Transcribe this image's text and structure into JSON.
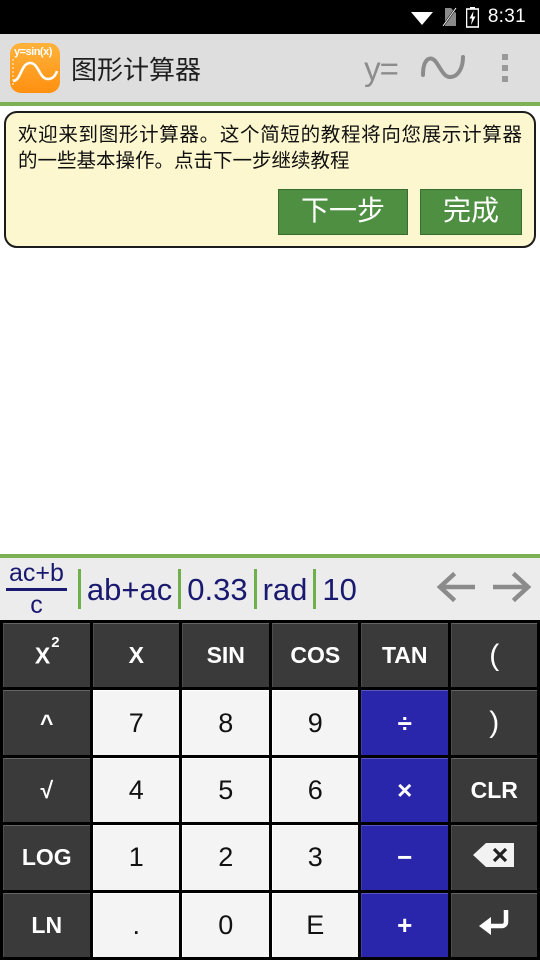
{
  "statusbar": {
    "time": "8:31",
    "icons": [
      "wifi-icon",
      "no-sim-icon",
      "battery-charging-icon"
    ]
  },
  "toolbar": {
    "app_icon_label": "y=sin(x)",
    "title": "图形计算器",
    "actions": [
      {
        "name": "y-equals-button",
        "label": "y="
      },
      {
        "name": "graph-curve-button",
        "label": ""
      },
      {
        "name": "overflow-menu-button",
        "label": ""
      }
    ]
  },
  "tutorial": {
    "text": "欢迎来到图形计算器。这个简短的教程将向您展示计算器的一些基本操作。点击下一步继续教程",
    "next_label": "下一步",
    "done_label": "完成"
  },
  "status_strip": {
    "fraction": {
      "numerator": "ac+b",
      "denominator": "c"
    },
    "expression": "ab+ac",
    "value": "0.33",
    "angle_mode": "rad",
    "base": "10",
    "prev_label": "←",
    "next_label": "→"
  },
  "keypad": {
    "rows": [
      [
        {
          "name": "key-x-squared",
          "label": "X",
          "sup": "2",
          "style": "fn"
        },
        {
          "name": "key-x",
          "label": "X",
          "style": "fn"
        },
        {
          "name": "key-sin",
          "label": "SIN",
          "style": "fn"
        },
        {
          "name": "key-cos",
          "label": "COS",
          "style": "fn"
        },
        {
          "name": "key-tan",
          "label": "TAN",
          "style": "fn"
        },
        {
          "name": "key-open-paren",
          "label": "(",
          "style": "fn-paren"
        }
      ],
      [
        {
          "name": "key-power",
          "label": "^",
          "style": "fn"
        },
        {
          "name": "key-7",
          "label": "7",
          "style": "num"
        },
        {
          "name": "key-8",
          "label": "8",
          "style": "num"
        },
        {
          "name": "key-9",
          "label": "9",
          "style": "num"
        },
        {
          "name": "key-divide",
          "label": "÷",
          "style": "op"
        },
        {
          "name": "key-close-paren",
          "label": ")",
          "style": "fn-paren"
        }
      ],
      [
        {
          "name": "key-sqrt",
          "label": "√",
          "style": "fn"
        },
        {
          "name": "key-4",
          "label": "4",
          "style": "num"
        },
        {
          "name": "key-5",
          "label": "5",
          "style": "num"
        },
        {
          "name": "key-6",
          "label": "6",
          "style": "num"
        },
        {
          "name": "key-multiply",
          "label": "×",
          "style": "op"
        },
        {
          "name": "key-clear",
          "label": "CLR",
          "style": "fn"
        }
      ],
      [
        {
          "name": "key-log",
          "label": "LOG",
          "style": "fn"
        },
        {
          "name": "key-1",
          "label": "1",
          "style": "num"
        },
        {
          "name": "key-2",
          "label": "2",
          "style": "num"
        },
        {
          "name": "key-3",
          "label": "3",
          "style": "num"
        },
        {
          "name": "key-minus",
          "label": "−",
          "style": "op"
        },
        {
          "name": "key-backspace",
          "label": "",
          "style": "fn-backspace"
        }
      ],
      [
        {
          "name": "key-ln",
          "label": "LN",
          "style": "fn"
        },
        {
          "name": "key-decimal-point",
          "label": ".",
          "style": "num"
        },
        {
          "name": "key-0",
          "label": "0",
          "style": "num"
        },
        {
          "name": "key-exponent",
          "label": "E",
          "style": "num"
        },
        {
          "name": "key-plus",
          "label": "+",
          "style": "op"
        },
        {
          "name": "key-enter",
          "label": "↵",
          "style": "fn-enter"
        }
      ]
    ]
  },
  "colors": {
    "accent_green": "#7cb254",
    "button_green": "#4e8f42",
    "operator_blue": "#2a26ac",
    "function_key": "#3a3a3a",
    "number_key": "#f4f4f4",
    "tutorial_bg": "#fcf7ce",
    "navy_text": "#191970"
  }
}
